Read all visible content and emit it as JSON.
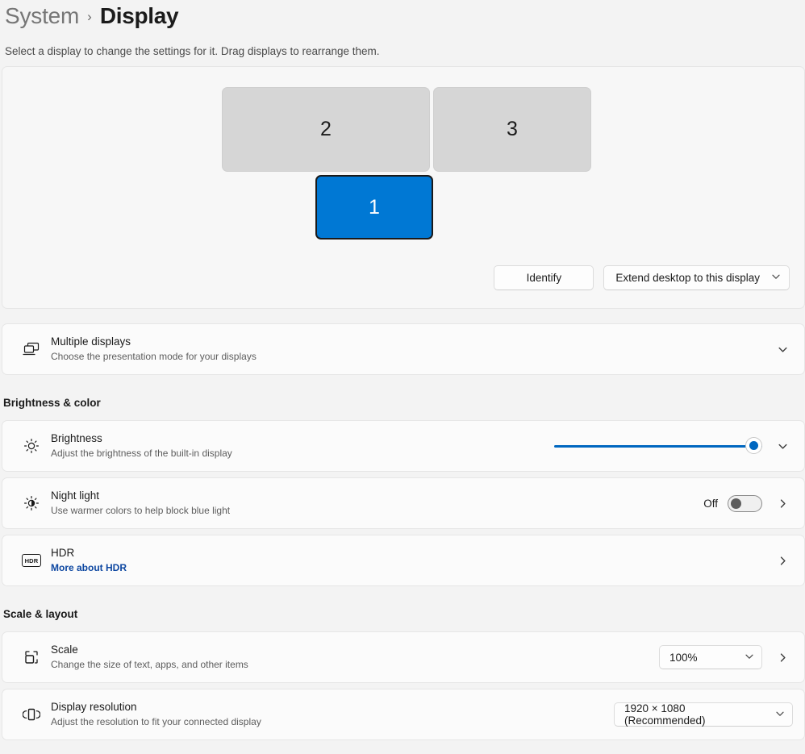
{
  "header": {
    "breadcrumb_root": "System",
    "breadcrumb_separator": "›",
    "breadcrumb_current": "Display",
    "subtitle": "Select a display to change the settings for it. Drag displays to rearrange them."
  },
  "arrangement": {
    "displays": [
      {
        "label": "2",
        "selected": false
      },
      {
        "label": "3",
        "selected": false
      },
      {
        "label": "1",
        "selected": true
      }
    ],
    "identify_button": "Identify",
    "mode_dropdown": "Extend desktop to this display"
  },
  "multiple_displays": {
    "title": "Multiple displays",
    "description": "Choose the presentation mode for your displays",
    "icon": "multiple-displays-icon"
  },
  "brightness_color": {
    "section_title": "Brightness & color",
    "brightness": {
      "title": "Brightness",
      "description": "Adjust the brightness of the built-in display",
      "icon": "brightness-sun-icon",
      "value": 100
    },
    "night_light": {
      "title": "Night light",
      "description": "Use warmer colors to help block blue light",
      "icon": "night-light-icon",
      "state": "Off"
    },
    "hdr": {
      "title": "HDR",
      "link": "More about HDR",
      "icon": "hdr-icon"
    }
  },
  "scale_layout": {
    "section_title": "Scale & layout",
    "scale": {
      "title": "Scale",
      "description": "Change the size of text, apps, and other items",
      "icon": "scale-icon",
      "value": "100%"
    },
    "resolution": {
      "title": "Display resolution",
      "description": "Adjust the resolution to fit your connected display",
      "icon": "display-resolution-icon",
      "value": "1920 × 1080 (Recommended)"
    }
  },
  "colors": {
    "accent": "#0078d4",
    "slider": "#0067c0",
    "link": "#0d47a1",
    "page_bg": "#f3f3f3",
    "card_bg": "#fbfbfb",
    "monitor_inactive": "#d6d6d6"
  }
}
